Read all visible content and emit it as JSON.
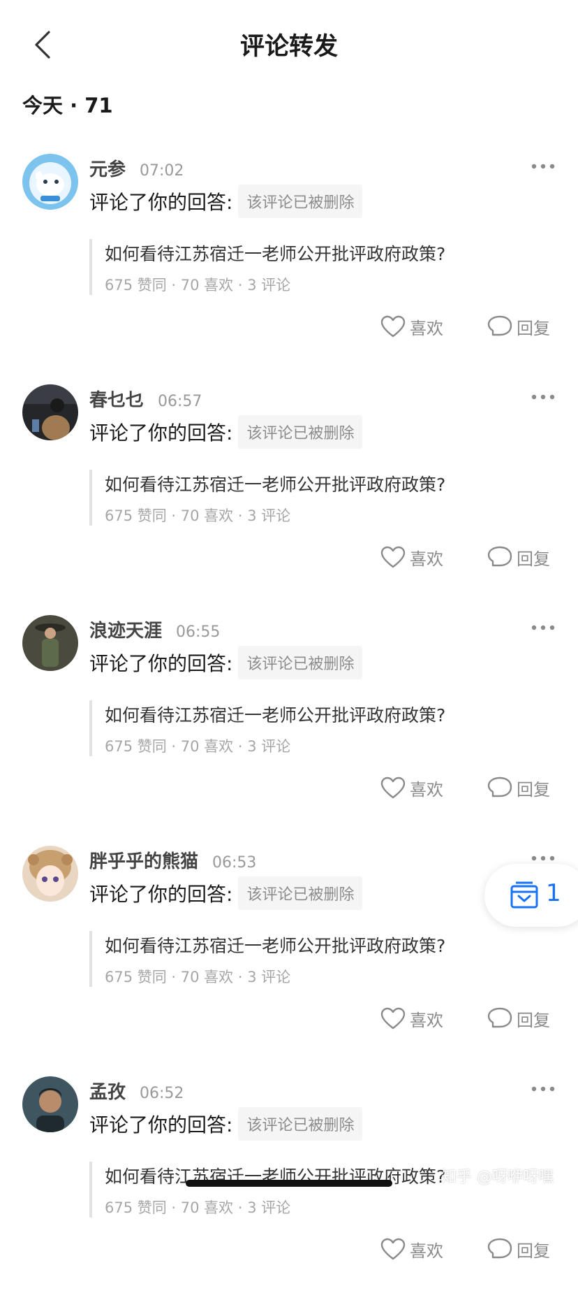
{
  "header": {
    "title": "评论转发",
    "back_icon": "chevron-left-icon"
  },
  "section": {
    "title": "今天 · 71"
  },
  "notifications": [
    {
      "username": "元参",
      "time": "07:02",
      "action": "评论了你的回答:",
      "deleted_tag": "该评论已被删除",
      "quote_title": "如何看待江苏宿迁一老师公开批评政府政策?",
      "quote_meta": "675 赞同 · 70 喜欢 · 3 评论",
      "like_label": "喜欢",
      "reply_label": "回复"
    },
    {
      "username": "春乜乜",
      "time": "06:57",
      "action": "评论了你的回答:",
      "deleted_tag": "该评论已被删除",
      "quote_title": "如何看待江苏宿迁一老师公开批评政府政策?",
      "quote_meta": "675 赞同 · 70 喜欢 · 3 评论",
      "like_label": "喜欢",
      "reply_label": "回复"
    },
    {
      "username": "浪迹天涯",
      "time": "06:55",
      "action": "评论了你的回答:",
      "deleted_tag": "该评论已被删除",
      "quote_title": "如何看待江苏宿迁一老师公开批评政府政策?",
      "quote_meta": "675 赞同 · 70 喜欢 · 3 评论",
      "like_label": "喜欢",
      "reply_label": "回复"
    },
    {
      "username": "胖乎乎的熊猫",
      "time": "06:53",
      "action": "评论了你的回答:",
      "deleted_tag": "该评论已被删除",
      "quote_title": "如何看待江苏宿迁一老师公开批评政府政策?",
      "quote_meta": "675 赞同 · 70 喜欢 · 3 评论",
      "like_label": "喜欢",
      "reply_label": "回复"
    },
    {
      "username": "孟孜",
      "time": "06:52",
      "action": "评论了你的回答:",
      "deleted_tag": "该评论已被删除",
      "quote_title": "如何看待江苏宿迁一老师公开批评政府政策?",
      "quote_meta": "675 赞同 · 70 喜欢 · 3 评论",
      "like_label": "喜欢",
      "reply_label": "回复"
    }
  ],
  "float_button": {
    "icon": "inbox-download-icon",
    "count": "1",
    "accent_color": "#1772f6"
  },
  "watermark": "知乎 @呀咿呀嘿"
}
